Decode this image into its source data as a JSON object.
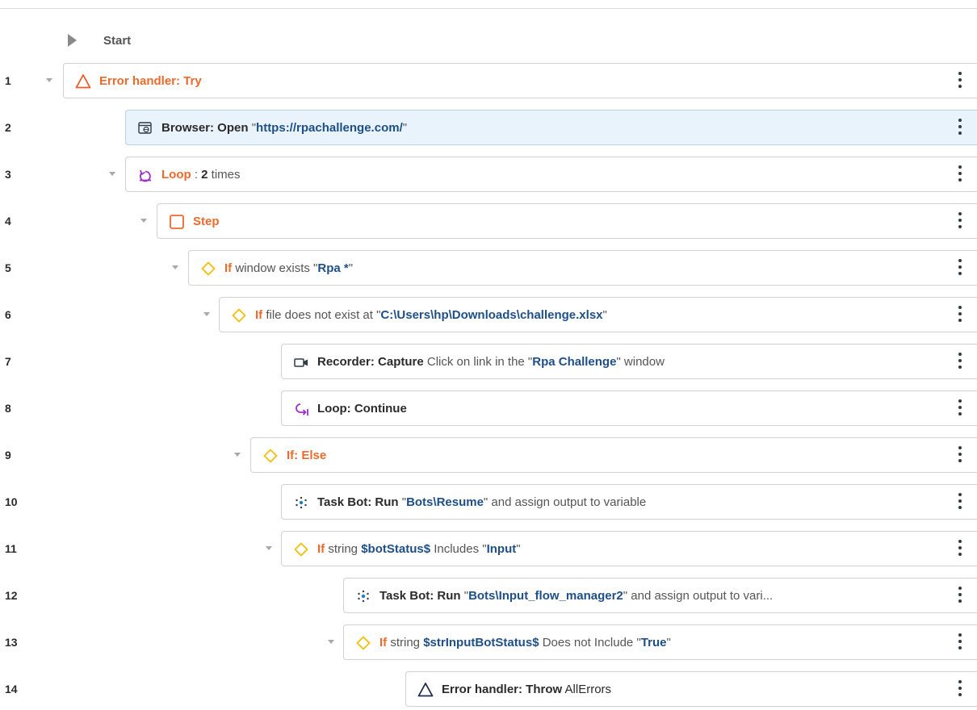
{
  "start_label": "Start",
  "rows": [
    {
      "num": "1",
      "icon": "warning-triangle-orange-icon",
      "t1": "Error handler: Try",
      "t2": "",
      "t3": "",
      "t4": "",
      "t5": ""
    },
    {
      "num": "2",
      "icon": "browser-icon",
      "t1": "Browser: Open",
      "t2": " \"",
      "t3": "https://rpachallenge.com/",
      "t4": "\"",
      "t5": ""
    },
    {
      "num": "3",
      "icon": "loop-icon",
      "t1": "Loop",
      "t2": " : ",
      "t3": "2",
      "t4": " times",
      "t5": ""
    },
    {
      "num": "4",
      "icon": "step-square-icon",
      "t1": "Step",
      "t2": "",
      "t3": "",
      "t4": "",
      "t5": ""
    },
    {
      "num": "5",
      "icon": "if-diamond-icon",
      "t1": "If",
      "t2": " window exists \"",
      "t3": "Rpa *",
      "t4": "\"",
      "t5": ""
    },
    {
      "num": "6",
      "icon": "if-diamond-icon",
      "t1": "If",
      "t2": " file does not exist at \"",
      "t3": "C:\\Users\\hp\\Downloads\\challenge.xlsx",
      "t4": "\"",
      "t5": ""
    },
    {
      "num": "7",
      "icon": "recorder-camera-icon",
      "t1": "Recorder: Capture",
      "t2": " Click on link in the \"",
      "t3": "Rpa Challenge",
      "t4": "\" window",
      "t5": ""
    },
    {
      "num": "8",
      "icon": "loop-continue-icon",
      "t1": "Loop: Continue",
      "t2": "",
      "t3": "",
      "t4": "",
      "t5": ""
    },
    {
      "num": "9",
      "icon": "if-diamond-icon",
      "t1": "If: Else",
      "t2": "",
      "t3": "",
      "t4": "",
      "t5": ""
    },
    {
      "num": "10",
      "icon": "task-bot-icon",
      "t1": "Task Bot: Run",
      "t2": " \"",
      "t3": "Bots\\Resume",
      "t4": "\" and assign output to variable",
      "t5": ""
    },
    {
      "num": "11",
      "icon": "if-diamond-icon",
      "t1": "If",
      "t2": " string ",
      "t3": "$botStatus$",
      "t4": " Includes \"",
      "t5": "Input"
    },
    {
      "num": "12",
      "icon": "task-bot-icon",
      "t1": "Task Bot: Run",
      "t2": " \"",
      "t3": "Bots\\Input_flow_manager2",
      "t4": "\" and assign output to vari...",
      "t5": ""
    },
    {
      "num": "13",
      "icon": "if-diamond-icon",
      "t1": "If",
      "t2": " string ",
      "t3": "$strInputBotStatus$",
      "t4": " Does not Include \"",
      "t5": "True"
    },
    {
      "num": "14",
      "icon": "throw-triangle-icon",
      "t1": "Error handler: Throw",
      "t2": " AllErrors",
      "t3": "",
      "t4": "",
      "t5": ""
    }
  ],
  "row11_tail": "\"",
  "row13_tail": "\""
}
